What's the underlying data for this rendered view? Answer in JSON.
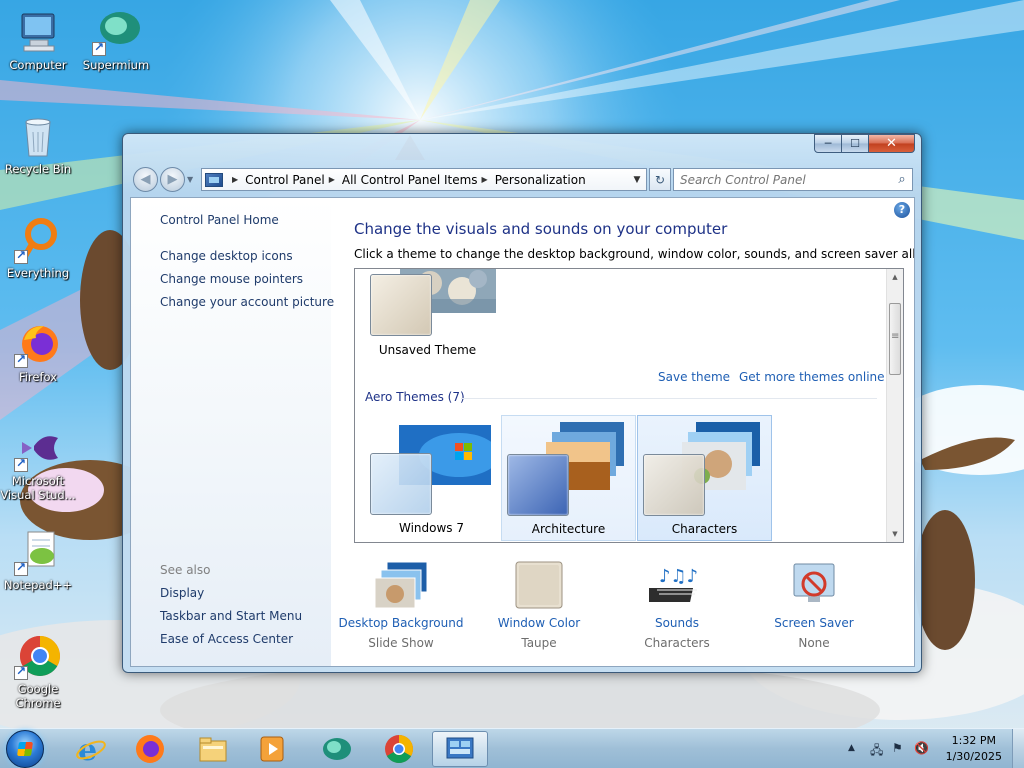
{
  "desktop": {
    "icons": [
      {
        "label": "Computer",
        "icon": "computer-icon"
      },
      {
        "label": "Supermium",
        "icon": "supermium-icon"
      },
      {
        "label": "Recycle Bin",
        "icon": "recycle-bin-icon"
      },
      {
        "label": "Everything",
        "icon": "everything-icon"
      },
      {
        "label": "Firefox",
        "icon": "firefox-icon"
      },
      {
        "label": "Microsoft Visual Stud...",
        "icon": "visual-studio-icon"
      },
      {
        "label": "Notepad++",
        "icon": "notepadpp-icon"
      },
      {
        "label": "Google Chrome",
        "icon": "chrome-icon"
      }
    ]
  },
  "window": {
    "controls": {
      "minimize": "─",
      "maximize": "☐",
      "close": "✕"
    },
    "nav": {
      "back": "◀",
      "forward": "▶",
      "recent": "▼"
    },
    "address": {
      "crumbs": [
        "Control Panel",
        "All Control Panel Items",
        "Personalization"
      ],
      "separator": "▶",
      "dropdown": "▼",
      "refresh": "↻"
    },
    "search": {
      "placeholder": "Search Control Panel",
      "icon": "⌕"
    }
  },
  "left_pane": {
    "home": "Control Panel Home",
    "tasks": [
      "Change desktop icons",
      "Change mouse pointers",
      "Change your account picture"
    ],
    "see_also_title": "See also",
    "see_also": [
      "Display",
      "Taskbar and Start Menu",
      "Ease of Access Center"
    ]
  },
  "main": {
    "help": "?",
    "title": "Change the visuals and sounds on your computer",
    "subtitle": "Click a theme to change the desktop background, window color, sounds, and screen saver all at once.",
    "my_themes": [
      {
        "name": "Unsaved Theme"
      }
    ],
    "links": {
      "save_theme": "Save theme",
      "get_more": "Get more themes online"
    },
    "aero_group": "Aero Themes (7)",
    "aero_themes": [
      {
        "name": "Windows 7",
        "state": "normal"
      },
      {
        "name": "Architecture",
        "state": "hover"
      },
      {
        "name": "Characters",
        "state": "selected"
      }
    ],
    "scroll": {
      "up": "▲",
      "down": "▼"
    },
    "settings": [
      {
        "label": "Desktop Background",
        "value": "Slide Show",
        "icon": "desktop-background-icon"
      },
      {
        "label": "Window Color",
        "value": "Taupe",
        "icon": "window-color-icon"
      },
      {
        "label": "Sounds",
        "value": "Characters",
        "icon": "sounds-icon"
      },
      {
        "label": "Screen Saver",
        "value": "None",
        "icon": "screen-saver-icon"
      }
    ]
  },
  "taskbar": {
    "pinned": [
      "internet-explorer-icon",
      "firefox-icon",
      "file-explorer-icon",
      "media-player-icon",
      "supermium-icon",
      "chrome-icon",
      "control-panel-icon"
    ],
    "tray": {
      "show_hidden": "▲",
      "network": "🖧",
      "flag": "⚑",
      "volume": "🔇"
    },
    "time": "1:32 PM",
    "date": "1/30/2025"
  },
  "colors": {
    "title_blue": "#1e3287",
    "link_blue": "#1f5fb4",
    "nav_link": "#1f3b6b",
    "muted_gray": "#6d6d6d"
  }
}
